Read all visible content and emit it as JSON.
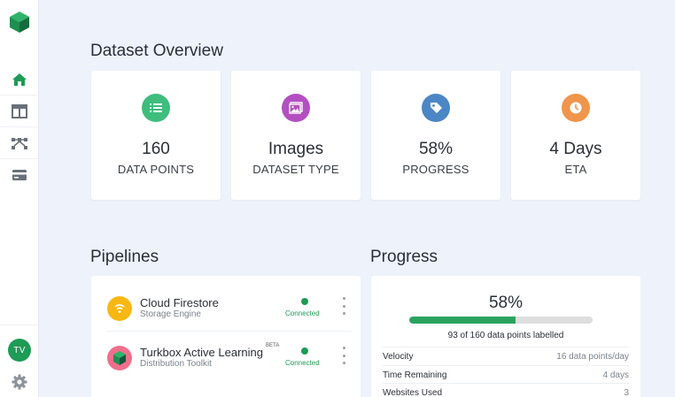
{
  "sidebar": {
    "avatar_initials": "TV",
    "nav": [
      "home-icon",
      "layout-icon",
      "pipeline-icon",
      "billing-icon"
    ],
    "active_color": "#1e9b55"
  },
  "overview": {
    "title": "Dataset Overview",
    "cards": [
      {
        "value": "160",
        "label": "DATA POINTS",
        "icon": "list-icon",
        "color": "#3ebd7c"
      },
      {
        "value": "Images",
        "label": "DATASET TYPE",
        "icon": "image-icon",
        "color": "#b44fc1"
      },
      {
        "value": "58%",
        "label": "PROGRESS",
        "icon": "tag-icon",
        "color": "#4b86c5"
      },
      {
        "value": "4 Days",
        "label": "ETA",
        "icon": "clock-icon",
        "color": "#f0954c"
      }
    ]
  },
  "pipelines": {
    "title": "Pipelines",
    "items": [
      {
        "name": "Cloud Firestore",
        "badge": "",
        "subtitle": "Storage Engine",
        "status": "Connected",
        "icon": "wifi-icon",
        "color": "#f7b814"
      },
      {
        "name": "Turkbox Active Learning",
        "badge": "BETA",
        "subtitle": "Distribution Toolkit",
        "status": "Connected",
        "icon": "cube-icon",
        "color": "#ef6f8b"
      }
    ]
  },
  "progress": {
    "title": "Progress",
    "percent_label": "58%",
    "fraction": 0.58,
    "caption": "93 of 160 data points labelled",
    "rows": [
      {
        "key": "Velocity",
        "value": "16 data points/day"
      },
      {
        "key": "Time Remaining",
        "value": "4 days"
      },
      {
        "key": "Websites Used",
        "value": "3"
      }
    ]
  }
}
